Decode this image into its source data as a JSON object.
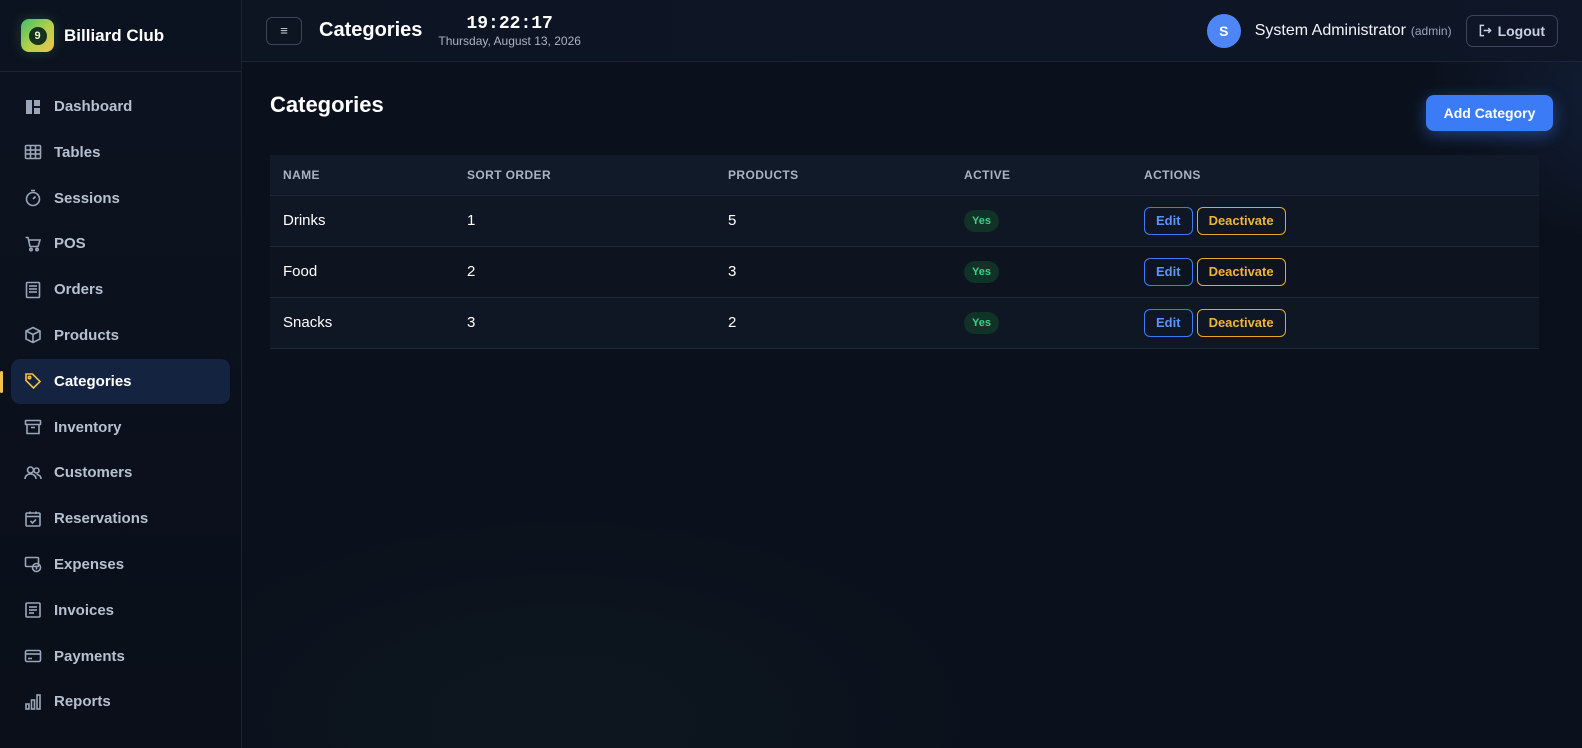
{
  "brand": {
    "logo_text": "9",
    "name": "Billiard Club"
  },
  "sidebar": {
    "items": [
      {
        "label": "Dashboard",
        "icon": "dashboard-icon",
        "active": false
      },
      {
        "label": "Tables",
        "icon": "table-grid-icon",
        "active": false
      },
      {
        "label": "Sessions",
        "icon": "timer-icon",
        "active": false
      },
      {
        "label": "POS",
        "icon": "cart-icon",
        "active": false
      },
      {
        "label": "Orders",
        "icon": "receipt-icon",
        "active": false
      },
      {
        "label": "Products",
        "icon": "box-icon",
        "active": false
      },
      {
        "label": "Categories",
        "icon": "tag-icon",
        "active": true
      },
      {
        "label": "Inventory",
        "icon": "archive-icon",
        "active": false
      },
      {
        "label": "Customers",
        "icon": "users-icon",
        "active": false
      },
      {
        "label": "Reservations",
        "icon": "calendar-check-icon",
        "active": false
      },
      {
        "label": "Expenses",
        "icon": "money-icon",
        "active": false
      },
      {
        "label": "Invoices",
        "icon": "invoice-icon",
        "active": false
      },
      {
        "label": "Payments",
        "icon": "credit-card-icon",
        "active": false
      },
      {
        "label": "Reports",
        "icon": "bar-chart-icon",
        "active": false
      }
    ]
  },
  "header": {
    "menu_icon": "≡",
    "title": "Categories",
    "time": "19:22:17",
    "date": "Thursday, August 13, 2026",
    "user": {
      "initial": "S",
      "name": "System Administrator",
      "role": "(admin)"
    },
    "logout_label": "Logout"
  },
  "page": {
    "title": "Categories",
    "add_button": "Add Category",
    "columns": [
      "NAME",
      "SORT ORDER",
      "PRODUCTS",
      "ACTIVE",
      "ACTIONS"
    ],
    "rows": [
      {
        "name": "Drinks",
        "sort_order": "1",
        "products": "5",
        "active": "Yes",
        "edit": "Edit",
        "deactivate": "Deactivate"
      },
      {
        "name": "Food",
        "sort_order": "2",
        "products": "3",
        "active": "Yes",
        "edit": "Edit",
        "deactivate": "Deactivate"
      },
      {
        "name": "Snacks",
        "sort_order": "3",
        "products": "2",
        "active": "Yes",
        "edit": "Edit",
        "deactivate": "Deactivate"
      }
    ]
  },
  "colors": {
    "accent": "#3b7bf6",
    "active_nav_marker": "#f2c14e",
    "active_badge_text": "#3ccf8a",
    "deactivate": "#f0b43a"
  }
}
